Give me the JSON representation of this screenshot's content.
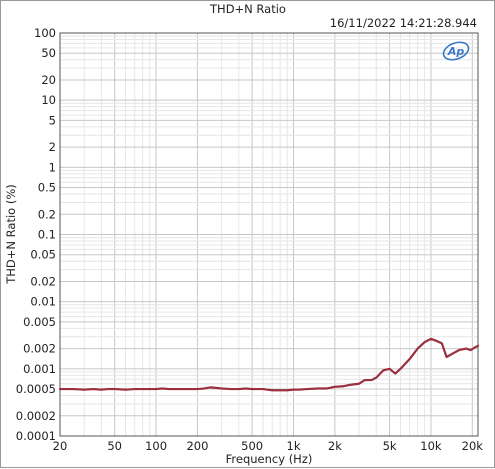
{
  "window": {
    "title": "THD+N Ratio",
    "timestamp": "16/11/2022 14:21:28.944"
  },
  "logo": {
    "text": "Ap",
    "icon": "ap-logo-icon",
    "color": "#3a78c9"
  },
  "colors": {
    "trace": "#9b2f3f",
    "grid_major": "#c8c8c8",
    "grid_minor": "#e6e6e6",
    "axis": "#555555"
  },
  "chart_data": {
    "type": "line",
    "title": "THD+N Ratio",
    "xlabel": "Frequency (Hz)",
    "ylabel": "THD+N Ratio (%)",
    "xscale": "log",
    "yscale": "log",
    "xlim": [
      20,
      22000
    ],
    "ylim": [
      0.0001,
      100
    ],
    "grid": true,
    "x_ticks": [
      {
        "value": 20,
        "label": "20"
      },
      {
        "value": 50,
        "label": "50"
      },
      {
        "value": 100,
        "label": "100"
      },
      {
        "value": 200,
        "label": "200"
      },
      {
        "value": 500,
        "label": "500"
      },
      {
        "value": 1000,
        "label": "1k"
      },
      {
        "value": 2000,
        "label": "2k"
      },
      {
        "value": 5000,
        "label": "5k"
      },
      {
        "value": 10000,
        "label": "10k"
      },
      {
        "value": 20000,
        "label": "20k"
      }
    ],
    "y_ticks": [
      {
        "value": 100,
        "label": "100"
      },
      {
        "value": 50,
        "label": "50"
      },
      {
        "value": 20,
        "label": "20"
      },
      {
        "value": 10,
        "label": "10"
      },
      {
        "value": 5,
        "label": "5"
      },
      {
        "value": 2,
        "label": "2"
      },
      {
        "value": 1,
        "label": "1"
      },
      {
        "value": 0.5,
        "label": "0.5"
      },
      {
        "value": 0.2,
        "label": "0.2"
      },
      {
        "value": 0.1,
        "label": "0.1"
      },
      {
        "value": 0.05,
        "label": "0.05"
      },
      {
        "value": 0.02,
        "label": "0.02"
      },
      {
        "value": 0.01,
        "label": "0.01"
      },
      {
        "value": 0.005,
        "label": "0.005"
      },
      {
        "value": 0.002,
        "label": "0.002"
      },
      {
        "value": 0.001,
        "label": "0.001"
      },
      {
        "value": 0.0005,
        "label": "0.0005"
      },
      {
        "value": 0.0002,
        "label": "0.0002"
      },
      {
        "value": 0.0001,
        "label": "0.0001"
      }
    ],
    "series": [
      {
        "x": [
          20,
          25,
          30,
          35,
          40,
          45,
          50,
          60,
          70,
          80,
          90,
          100,
          110,
          125,
          150,
          175,
          200,
          225,
          250,
          300,
          350,
          400,
          450,
          500,
          600,
          700,
          800,
          900,
          1000,
          1100,
          1250,
          1500,
          1750,
          2000,
          2300,
          2600,
          3000,
          3300,
          3700,
          4000,
          4500,
          5000,
          5500,
          6000,
          7000,
          8000,
          9000,
          10000,
          11000,
          12000,
          13000,
          14500,
          16000,
          18000,
          19500,
          21000,
          22000
        ],
        "y": [
          0.0005,
          0.0005,
          0.00049,
          0.0005,
          0.00049,
          0.0005,
          0.0005,
          0.00049,
          0.0005,
          0.0005,
          0.0005,
          0.0005,
          0.00051,
          0.0005,
          0.0005,
          0.0005,
          0.0005,
          0.00051,
          0.00053,
          0.00051,
          0.0005,
          0.0005,
          0.00051,
          0.0005,
          0.0005,
          0.00048,
          0.00048,
          0.00048,
          0.00049,
          0.00049,
          0.0005,
          0.00051,
          0.00051,
          0.00054,
          0.00055,
          0.00058,
          0.0006,
          0.00068,
          0.00068,
          0.00074,
          0.00095,
          0.001,
          0.00085,
          0.001,
          0.0014,
          0.002,
          0.0025,
          0.0028,
          0.0026,
          0.0024,
          0.0015,
          0.0017,
          0.0019,
          0.002,
          0.0019,
          0.0021,
          0.0022
        ]
      }
    ]
  }
}
